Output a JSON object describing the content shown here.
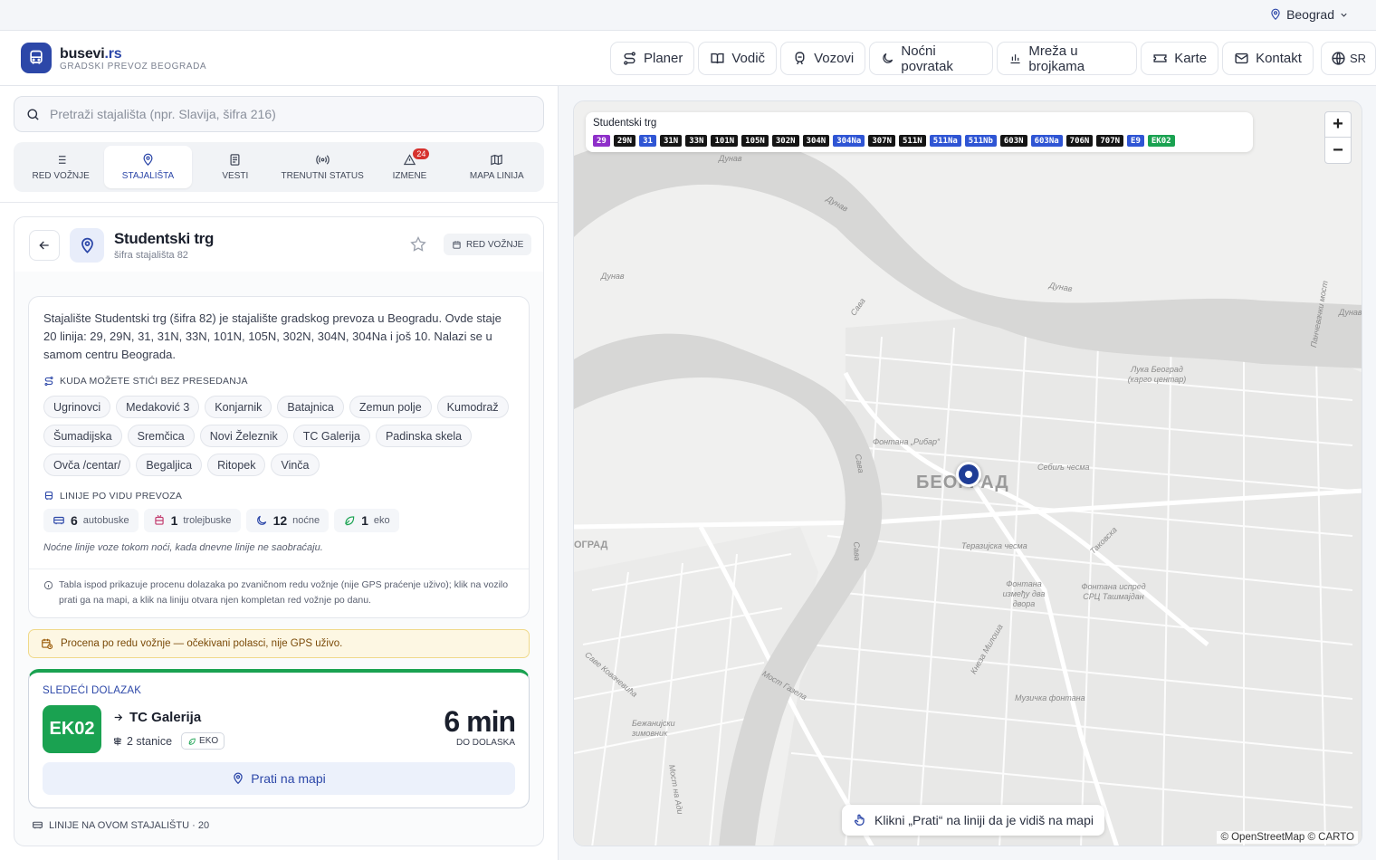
{
  "city_selector": {
    "label": "Beograd",
    "icon": "map-pin-icon"
  },
  "brand": {
    "name": "busevi",
    "tld": ".rs",
    "subtitle": "GRADSKI PREVOZ BEOGRADA"
  },
  "nav": {
    "planer": "Planer",
    "vodic": "Vodič",
    "vozovi": "Vozovi",
    "nocni": "Noćni povratak",
    "mreza": "Mreža u brojkama",
    "karte": "Karte",
    "kontakt": "Kontakt",
    "lang": "SR"
  },
  "search": {
    "placeholder": "Pretraži stajališta (npr. Slavija, šifra 216)"
  },
  "tabs": {
    "red_voznje": "RED VOŽNJE",
    "stajalista": "STAJALIŠTA",
    "vesti": "VESTI",
    "status": "TRENUTNI STATUS",
    "izmene": "IZMENE",
    "izmene_count": "24",
    "mapa": "MAPA LINIJA"
  },
  "stop": {
    "name": "Studentski trg",
    "code": "šifra stajališta 82",
    "timetable_button": "RED VOŽNJE",
    "description": "Stajalište Studentski trg (šifra 82) je stajalište gradskog prevoza u Beogradu. Ovde staje 20 linija: 29, 29N, 31, 31N, 33N, 101N, 105N, 302N, 304N, 304Na i još 10. Nalazi se u samom centru Beograda."
  },
  "destinations": {
    "title": "KUDA MOŽETE STIĆI BEZ PRESEDANJA",
    "items": [
      "Ugrinovci",
      "Medaković 3",
      "Konjarnik",
      "Batajnica",
      "Zemun polje",
      "Kumodraž",
      "Šumadijska",
      "Sremčica",
      "Novi Železnik",
      "TC Galerija",
      "Padinska skela",
      "Ovča /centar/",
      "Begaljica",
      "Ritopek",
      "Vinča"
    ]
  },
  "line_types": {
    "title": "LINIJE PO VIDU PREVOZA",
    "bus_count": "6",
    "bus_label": "autobuske",
    "trolley_count": "1",
    "trolley_label": "trolejbuske",
    "night_count": "12",
    "night_label": "noćne",
    "eco_count": "1",
    "eco_label": "eko",
    "note": "Noćne linije voze tokom noći, kada dnevne linije ne saobraćaju."
  },
  "tabla_note": "Tabla ispod prikazuje procenu dolazaka po zvaničnom redu vožnje (nije GPS praćenje uživo); klik na vozilo prati ga na mapi, a klik na liniju otvara njen kompletan red vožnje po danu.",
  "warning": "Procena po redu vožnje — očekivani polasci, nije GPS uživo.",
  "next_arrival": {
    "label": "SLEDEĆI DOLAZAK",
    "route": "EK02",
    "destination": "TC Galerija",
    "stations": "2 stanice",
    "tag": "EKO",
    "minutes": "6 min",
    "minutes_label": "DO DOLASKA",
    "follow_button": "Prati na mapi",
    "accent_color": "#1aa251"
  },
  "lines_section": "LINIJE NA OVOM STAJALIŠTU · 20",
  "map": {
    "panel_title": "Studentski trg",
    "lines": [
      {
        "label": "29",
        "color": "#8e2fc9"
      },
      {
        "label": "29N",
        "color": "#151515"
      },
      {
        "label": "31",
        "color": "#2f55d4"
      },
      {
        "label": "31N",
        "color": "#151515"
      },
      {
        "label": "33N",
        "color": "#151515"
      },
      {
        "label": "101N",
        "color": "#151515"
      },
      {
        "label": "105N",
        "color": "#151515"
      },
      {
        "label": "302N",
        "color": "#151515"
      },
      {
        "label": "304N",
        "color": "#151515"
      },
      {
        "label": "304Na",
        "color": "#2f55d4"
      },
      {
        "label": "307N",
        "color": "#151515"
      },
      {
        "label": "511N",
        "color": "#151515"
      },
      {
        "label": "511Na",
        "color": "#2f55d4"
      },
      {
        "label": "511Nb",
        "color": "#2f55d4"
      },
      {
        "label": "603N",
        "color": "#151515"
      },
      {
        "label": "603Na",
        "color": "#2f55d4"
      },
      {
        "label": "706N",
        "color": "#151515"
      },
      {
        "label": "707N",
        "color": "#151515"
      },
      {
        "label": "E9",
        "color": "#2f55d4"
      },
      {
        "label": "EK02",
        "color": "#1aa251"
      }
    ],
    "city_label": "БЕОГРАД",
    "labels": {
      "dunav1": "Дунав",
      "dunav2": "Дунав",
      "dunav3": "Дунав",
      "dunav4": "Дунав",
      "dunav5": "Дунав",
      "sava1": "Сава",
      "sava2": "Сава",
      "sava3": "Сава",
      "luka": "Лука Београд (карго центар)",
      "ribar": "Фонтана „Рибар“",
      "sebilj": "Себиљ чесма",
      "terazijska": "Теразијска чесма",
      "fontana_dva": "Фонтана између два двора",
      "fontana_src": "Фонтана испред СРЦ Ташмајдан",
      "muzicka": "Музичка фонтана",
      "beg_left": "ОГРАД",
      "most": "Панчевачки мост",
      "takovska": "Таковска",
      "gazela": "Мост Газела",
      "knez": "Кнеза Милоша",
      "kosara": "Саве Ковачевића",
      "zimovnik": "Бежанијски зимовник",
      "ada": "Мост на Ади"
    },
    "zoom_in": "+",
    "zoom_out": "−",
    "hint": "Klikni „Prati“ na liniji da je vidiš na mapi",
    "attribution": "© OpenStreetMap © CARTO"
  }
}
